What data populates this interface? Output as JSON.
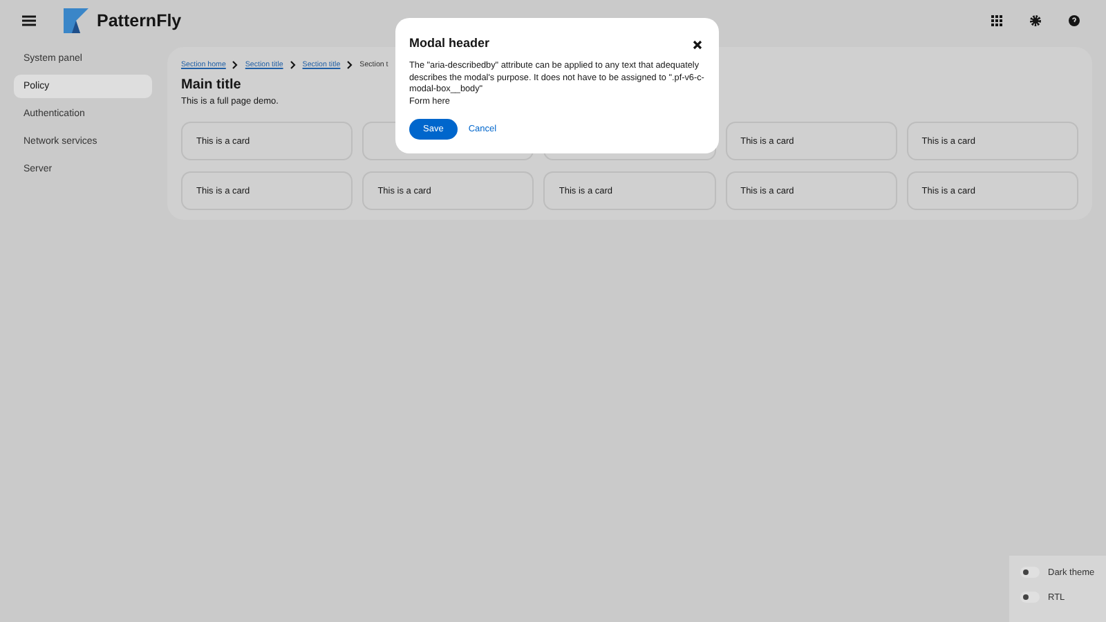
{
  "masthead": {
    "brand": "PatternFly"
  },
  "sidebar": {
    "items": [
      {
        "label": "System panel",
        "selected": false
      },
      {
        "label": "Policy",
        "selected": true
      },
      {
        "label": "Authentication",
        "selected": false
      },
      {
        "label": "Network services",
        "selected": false
      },
      {
        "label": "Server",
        "selected": false
      }
    ]
  },
  "breadcrumb": [
    {
      "label": "Section home",
      "kind": "link"
    },
    {
      "label": "Section title",
      "kind": "link"
    },
    {
      "label": "Section title",
      "kind": "link"
    },
    {
      "label": "Section t",
      "kind": "current"
    }
  ],
  "page": {
    "title": "Main title",
    "description": "This is a full page demo."
  },
  "cards": [
    {
      "kind": "text",
      "text": "This is a card"
    },
    {
      "kind": "covered"
    },
    {
      "kind": "covered"
    },
    {
      "kind": "text",
      "text": "This is a card"
    },
    {
      "kind": "text",
      "text": "This is a card"
    },
    {
      "kind": "text",
      "text": "This is a card"
    },
    {
      "kind": "text",
      "text": "This is a card"
    },
    {
      "kind": "text",
      "text": "This is a card"
    },
    {
      "kind": "text",
      "text": "This is a card"
    },
    {
      "kind": "text",
      "text": "This is a card"
    }
  ],
  "modal": {
    "title": "Modal header",
    "description": "The \"aria-describedby\" attribute can be applied to any text that adequately describes the modal's purpose. It does not have to be assigned to \".pf-v6-c-modal-box__body\"",
    "body": "Form here",
    "buttons": [
      {
        "label": "Save",
        "kind": "primary"
      },
      {
        "label": "Cancel",
        "kind": "link"
      }
    ]
  },
  "theme_panel": [
    {
      "label": "Dark theme",
      "on": false
    },
    {
      "label": "RTL",
      "on": false
    }
  ]
}
